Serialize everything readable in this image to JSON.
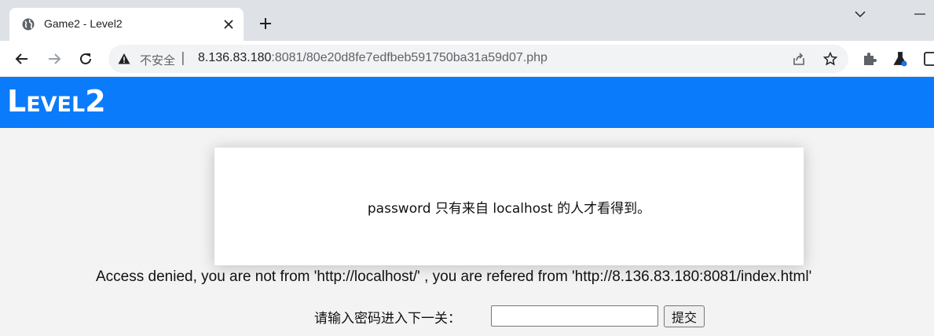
{
  "browser": {
    "tab": {
      "title": "Game2 - Level2",
      "favicon_icon": "globe-icon",
      "close_glyph": "✕"
    },
    "new_tab_glyph": "+",
    "address_bar": {
      "security_label": "不安全",
      "separator": "|",
      "url_host": "8.136.83.180",
      "url_rest": ":8081/80e20d8fe7edfbeb591750ba31a59d07.php"
    }
  },
  "page": {
    "banner_title": "Level2",
    "banner_color": "#0a7bfb",
    "card_message": "password 只有来自 localhost 的人才看得到。",
    "denied_message": "Access denied, you are not from 'http://localhost/' , you are refered from 'http://8.136.83.180:8081/index.html'",
    "form": {
      "label": "请输入密码进入下一关：",
      "password_value": "",
      "submit_label": "提交"
    }
  }
}
